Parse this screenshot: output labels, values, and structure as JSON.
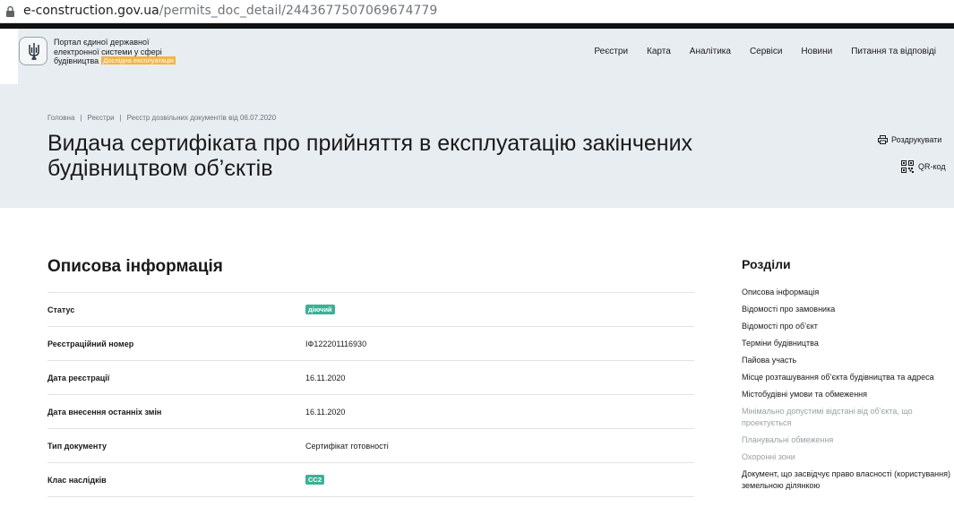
{
  "browser": {
    "url_host": "e-construction.gov.ua",
    "url_path": "/permits_doc_detail/2443677507069674779"
  },
  "header": {
    "portal_line1": "Портал єдиної державної",
    "portal_line2": "електронної системи у сфері",
    "portal_line3": "будівництва",
    "beta_badge": "Дослідна експлуатація",
    "nav": [
      {
        "label": "Реєстри"
      },
      {
        "label": "Карта"
      },
      {
        "label": "Аналітика"
      },
      {
        "label": "Сервіси"
      },
      {
        "label": "Новини"
      },
      {
        "label": "Питання та відповіді"
      }
    ]
  },
  "breadcrumb": [
    {
      "label": "Головна"
    },
    {
      "label": "Реєстри"
    },
    {
      "label": "Реєстр дозвільних документів від 06.07.2020"
    }
  ],
  "page": {
    "title_line1": "Видача сертифіката про прийняття в експлуатацію закінчених",
    "title_line2": "будівництвом об’єктів",
    "print_label": "Роздрукувати",
    "qr_label": "QR-код"
  },
  "description": {
    "title": "Описова інформація",
    "rows": [
      {
        "label": "Статус",
        "value": "діючий",
        "is_badge": true
      },
      {
        "label": "Реєстраційний номер",
        "value": "ІФ122201116930"
      },
      {
        "label": "Дата реєстрації",
        "value": "16.11.2020"
      },
      {
        "label": "Дата внесення останніх змін",
        "value": "16.11.2020"
      },
      {
        "label": "Тип документу",
        "value": "Сертифікат готовності"
      },
      {
        "label": "Клас наслідків",
        "value": "СС2",
        "is_badge": true
      }
    ]
  },
  "sections": {
    "title": "Розділи",
    "items": [
      {
        "label": "Описова інформація"
      },
      {
        "label": "Відомості про замовника"
      },
      {
        "label": "Відомості про об’єкт"
      },
      {
        "label": "Терміни будівництва"
      },
      {
        "label": "Пайова участь"
      },
      {
        "label": "Місце розташування об’єкта будівництва та адреса"
      },
      {
        "label": "Містобудівні умови та обмеження"
      },
      {
        "label": "Мінімально допустимі відстані від об’єкта, що проектується",
        "dim": true
      },
      {
        "label": "Планувальні обмеження",
        "dim": true
      },
      {
        "label": "Охоронні зони",
        "dim": true
      },
      {
        "label": "Документ, що засвідчує право власності (користування) земельною ділянкою"
      }
    ]
  },
  "colors": {
    "badge_green": "#3bb295",
    "beta_orange": "#f2b445",
    "hero_bg": "#e8edf2"
  },
  "icons": [
    "lock-icon",
    "trident-icon",
    "printer-icon",
    "qr-code-icon"
  ]
}
